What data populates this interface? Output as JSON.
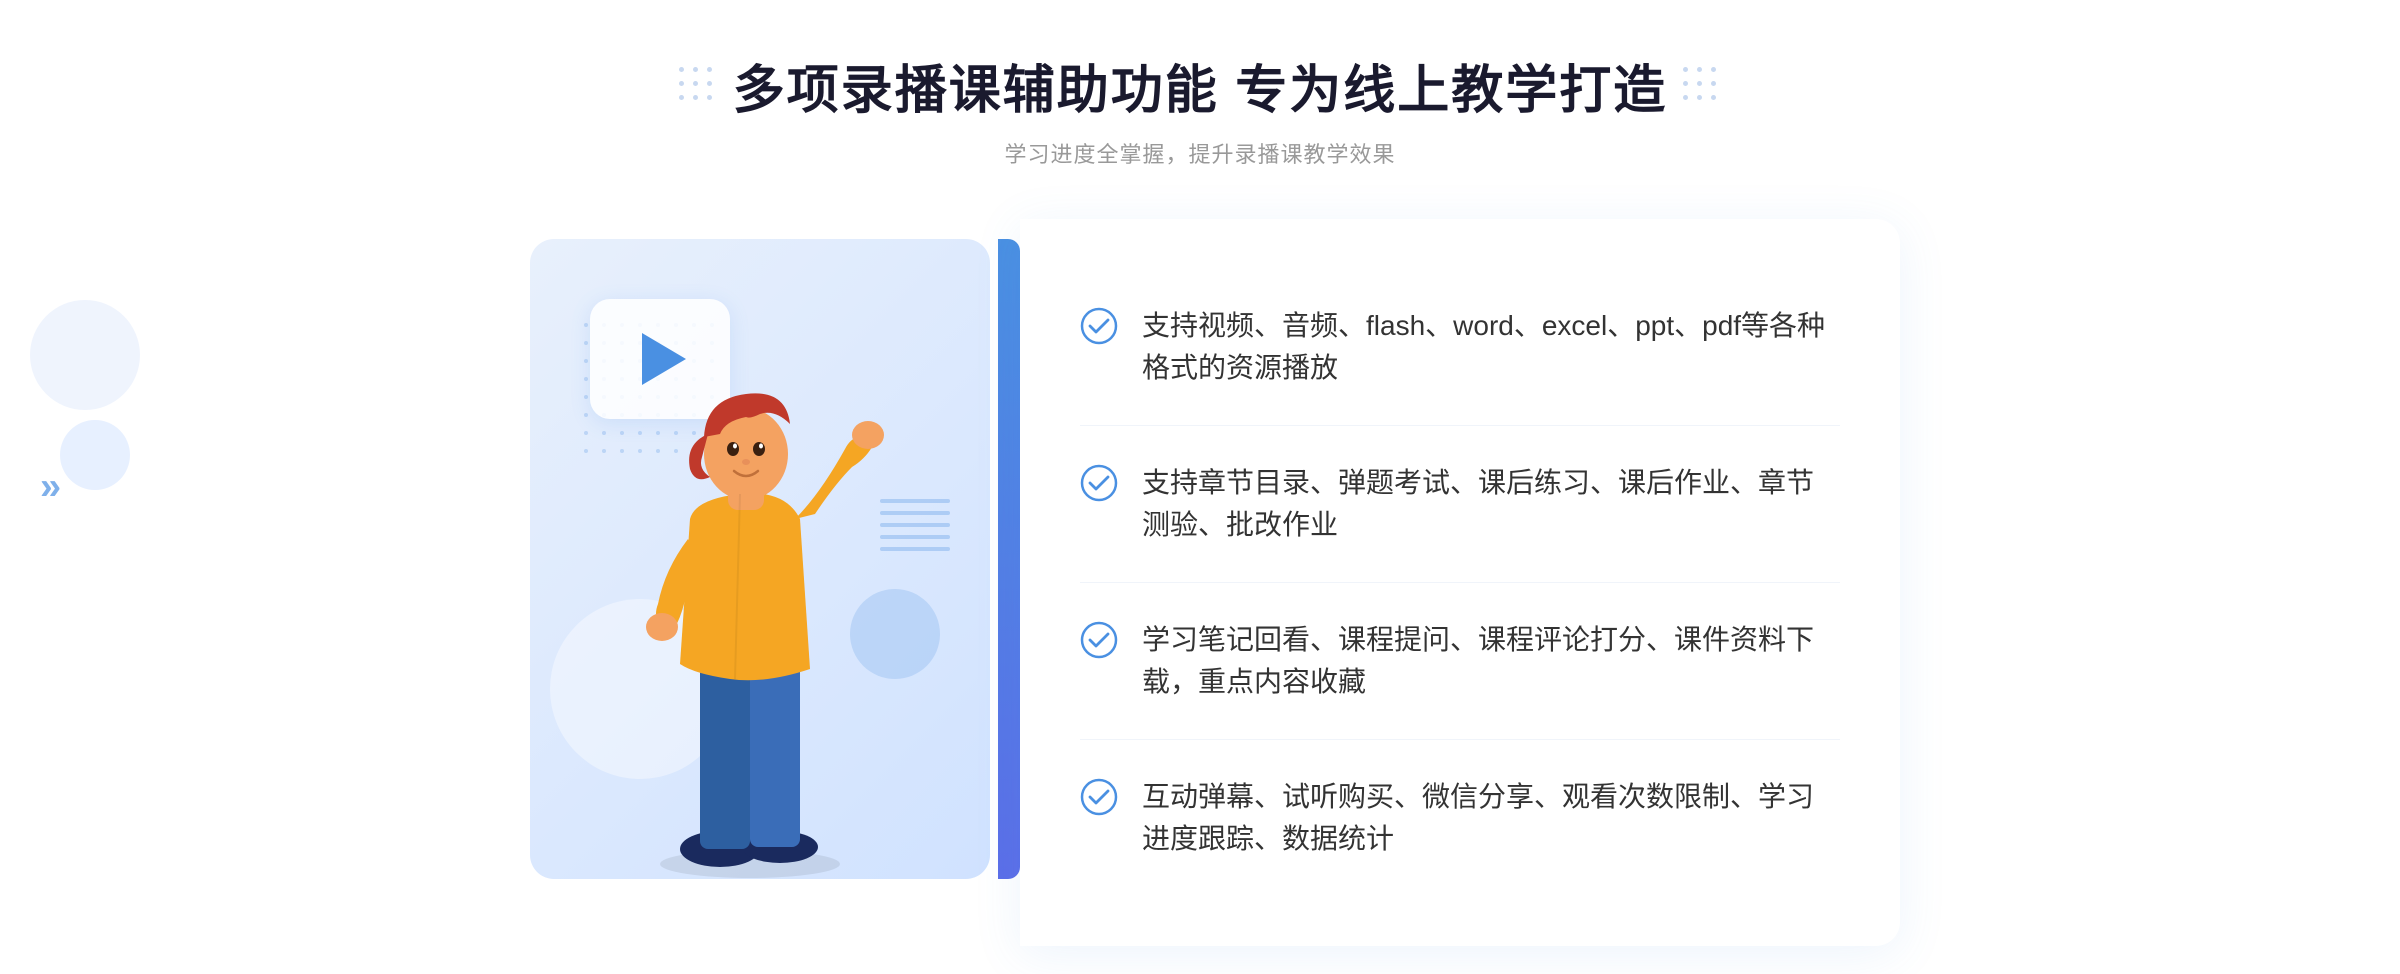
{
  "header": {
    "title": "多项录播课辅助功能 专为线上教学打造",
    "subtitle": "学习进度全掌握，提升录播课教学效果"
  },
  "features": [
    {
      "id": 1,
      "text": "支持视频、音频、flash、word、excel、ppt、pdf等各种格式的资源播放"
    },
    {
      "id": 2,
      "text": "支持章节目录、弹题考试、课后练习、课后作业、章节测验、批改作业"
    },
    {
      "id": 3,
      "text": "学习笔记回看、课程提问、课程评论打分、课件资料下载，重点内容收藏"
    },
    {
      "id": 4,
      "text": "互动弹幕、试听购买、微信分享、观看次数限制、学习进度跟踪、数据统计"
    }
  ],
  "decorations": {
    "left_chevron": "»"
  }
}
